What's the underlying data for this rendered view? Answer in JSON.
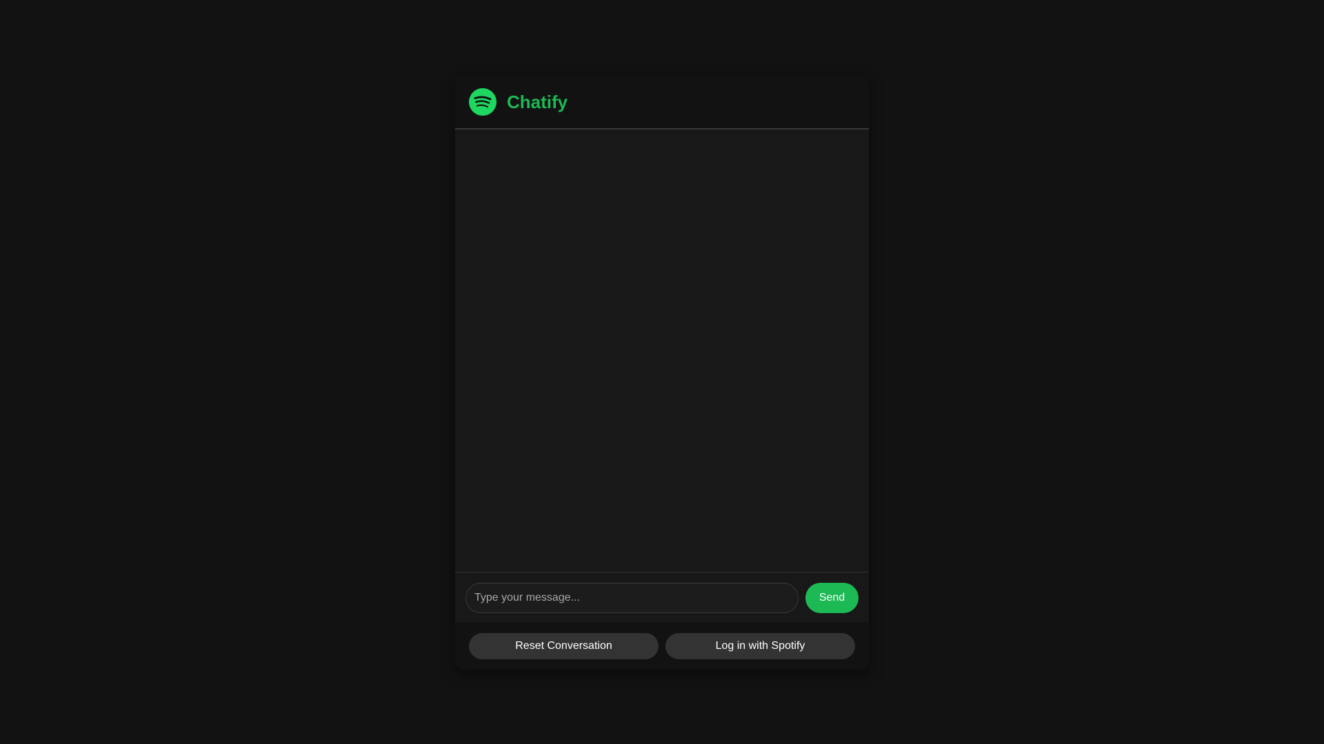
{
  "app": {
    "title": "Chatify",
    "logo_icon": "spotify-logo-icon",
    "accent_color": "#1db954"
  },
  "composer": {
    "placeholder": "Type your message...",
    "value": "",
    "send_label": "Send"
  },
  "actions": {
    "reset_label": "Reset Conversation",
    "login_label": "Log in with Spotify"
  },
  "messages": []
}
